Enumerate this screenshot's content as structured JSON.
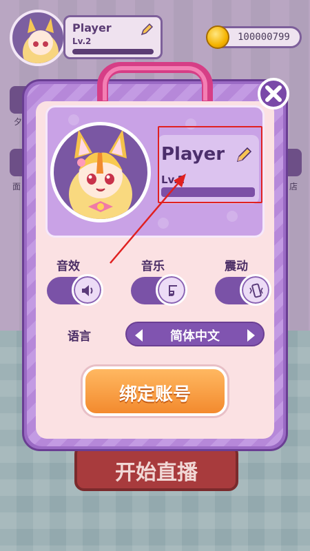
{
  "header": {
    "player_name": "Player",
    "level": "Lv.2",
    "coins": "100000799"
  },
  "background": {
    "side_labels": [
      "夕",
      "面",
      "店"
    ],
    "start_button": "开始直播"
  },
  "settings_dialog": {
    "player_name": "Player",
    "level": "Lv.2",
    "toggles": [
      {
        "label": "音效",
        "icon": "speaker-icon",
        "on": true
      },
      {
        "label": "音乐",
        "icon": "music-note-icon",
        "on": true
      },
      {
        "label": "震动",
        "icon": "vibrate-icon",
        "on": true
      }
    ],
    "language": {
      "label": "语言",
      "value": "简体中文"
    },
    "bind_button": "绑定账号"
  },
  "colors": {
    "accent_purple": "#7a52a7",
    "handle_pink": "#d63e86",
    "bind_orange": "#f38a2e",
    "highlight_red": "#e02020"
  }
}
